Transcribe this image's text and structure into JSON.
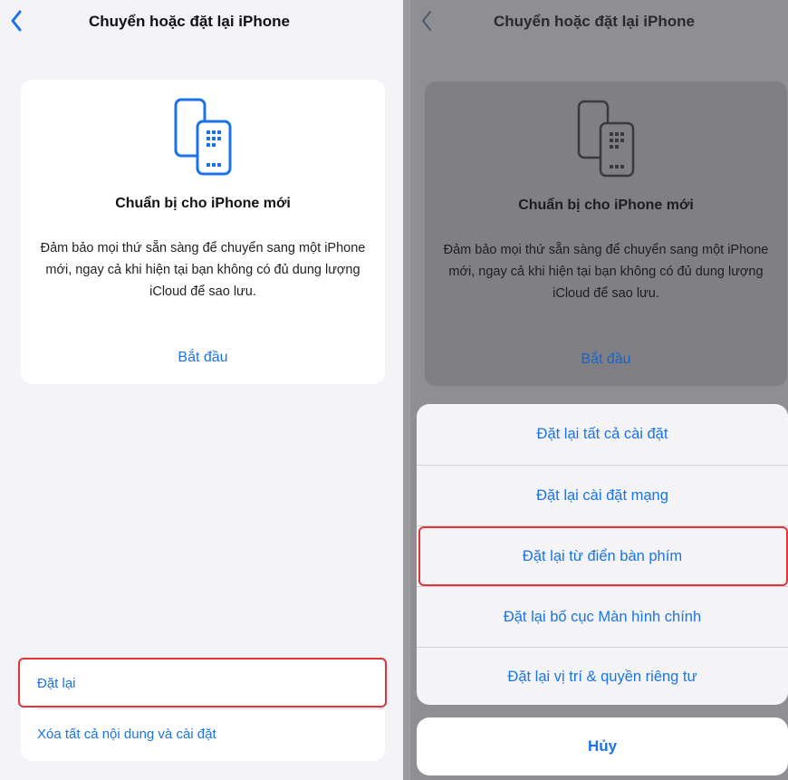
{
  "left": {
    "nav_title": "Chuyển hoặc đặt lại iPhone",
    "back_icon": "chevron-left-icon",
    "card": {
      "icon": "transfer-phones-icon",
      "title": "Chuẩn bị cho iPhone mới",
      "description": "Đảm bảo mọi thứ sẵn sàng để chuyển sang một iPhone mới, ngay cả khi hiện tại bạn không có đủ dung lượng iCloud để sao lưu.",
      "link": "Bắt đầu"
    },
    "reset_items": [
      "Đặt lại",
      "Xóa tất cả nội dung và cài đặt"
    ]
  },
  "right": {
    "nav_title": "Chuyển hoặc đặt lại iPhone",
    "back_icon": "chevron-left-icon",
    "card": {
      "icon": "transfer-phones-icon",
      "title": "Chuẩn bị cho iPhone mới",
      "description": "Đảm bảo mọi thứ sẵn sàng để chuyển sang một iPhone mới, ngay cả khi hiện tại bạn không có đủ dung lượng iCloud để sao lưu.",
      "link": "Bắt đầu"
    },
    "sheet_options": [
      "Đặt lại tất cả cài đặt",
      "Đặt lại cài đặt mạng",
      "Đặt lại từ điển bàn phím",
      "Đặt lại bố cục Màn hình chính",
      "Đặt lại vị trí & quyền riêng tư"
    ],
    "cancel_label": "Hủy"
  },
  "colors": {
    "accent": "#1a73e8",
    "highlight": "#e0353d",
    "background": "#f2f2f7"
  }
}
